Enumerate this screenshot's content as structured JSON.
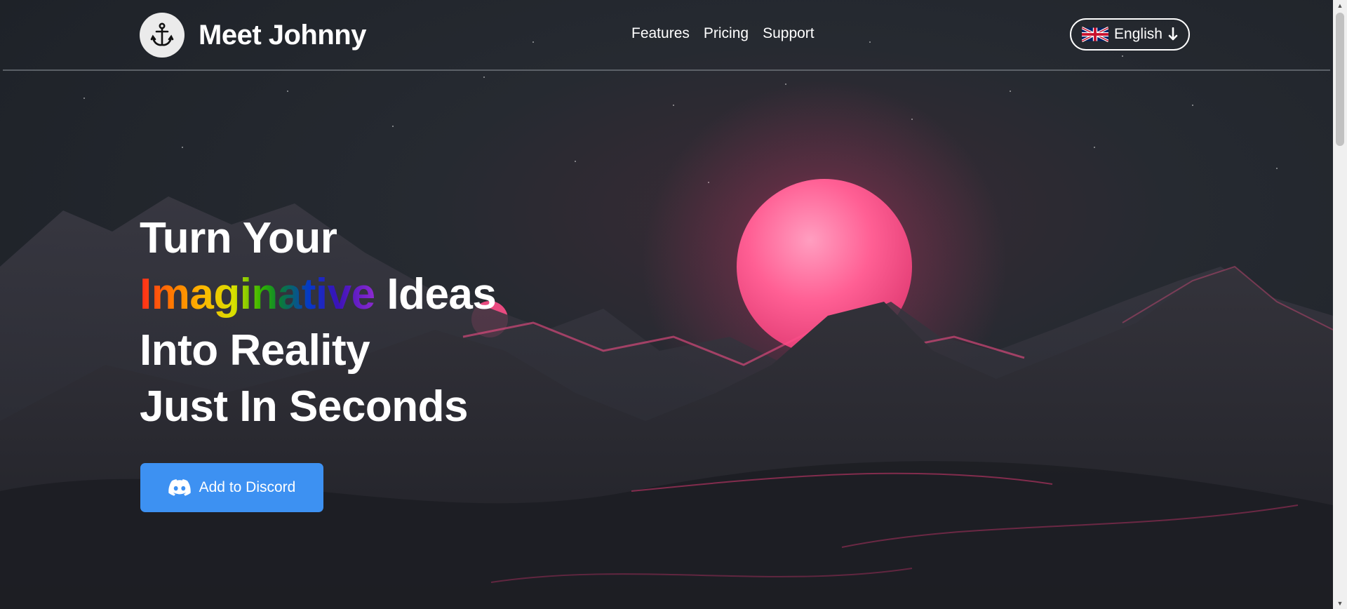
{
  "header": {
    "brand": "Meet Johnny",
    "logo_icon": "anchor-icon",
    "nav": [
      "Features",
      "Pricing",
      "Support"
    ],
    "language": {
      "label": "English",
      "flag_icon": "uk-flag-icon",
      "arrow_icon": "arrow-down-icon"
    }
  },
  "hero": {
    "line1": "Turn Your",
    "line2_highlight": "Imaginative",
    "line2_rest": " Ideas",
    "line3": "Into Reality",
    "line4": "Just In Seconds",
    "cta": {
      "label": "Add to Discord",
      "icon": "discord-icon",
      "color": "#3d91f2"
    }
  },
  "colors": {
    "background": "#20242b",
    "moon": "#ff4f8a",
    "accent": "#3d91f2"
  }
}
